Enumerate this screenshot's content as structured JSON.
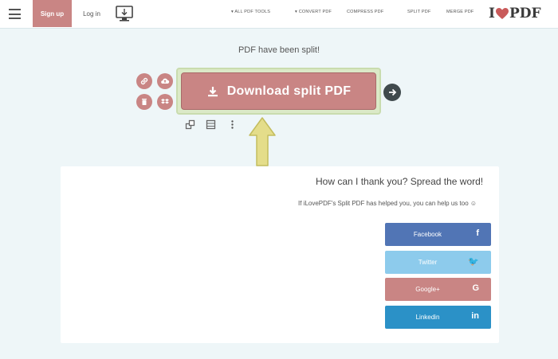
{
  "header": {
    "signup_label": "Sign up",
    "login_label": "Log in",
    "nav": {
      "all_tools": "▾ ALL PDF TOOLS",
      "convert": "▾ CONVERT PDF",
      "compress": "COMPRESS PDF",
      "split": "SPLIT PDF",
      "merge": "MERGE PDF"
    },
    "logo_left": "I",
    "logo_right": "PDF"
  },
  "main": {
    "status_text": "PDF have been split!",
    "download_label": "Download split PDF"
  },
  "share": {
    "title": "How can I thank you? Spread the word!",
    "text": "If iLovePDF's Split PDF has helped you, you can help us too ☺",
    "buttons": [
      {
        "label": "Facebook",
        "icon": "f",
        "color": "#5175b5"
      },
      {
        "label": "Twitter",
        "icon": "🐦",
        "color": "#8dcbec"
      },
      {
        "label": "Google+",
        "icon": "G",
        "color": "#c98584"
      },
      {
        "label": "Linkedin",
        "icon": "in",
        "color": "#2b91c7"
      }
    ]
  },
  "colors": {
    "brand": "#c98584",
    "background": "#eef6f8",
    "frame_highlight": "#c9dcae",
    "arrow_yellow": "#e4dd8a"
  },
  "icons": [
    "hamburger-icon",
    "desktop-download-icon",
    "heart-logo-icon",
    "link-icon",
    "upload-icon",
    "trash-icon",
    "dropbox-icon",
    "download-icon",
    "arrow-right-icon",
    "expand-icon",
    "grid-icon",
    "more-icon"
  ]
}
